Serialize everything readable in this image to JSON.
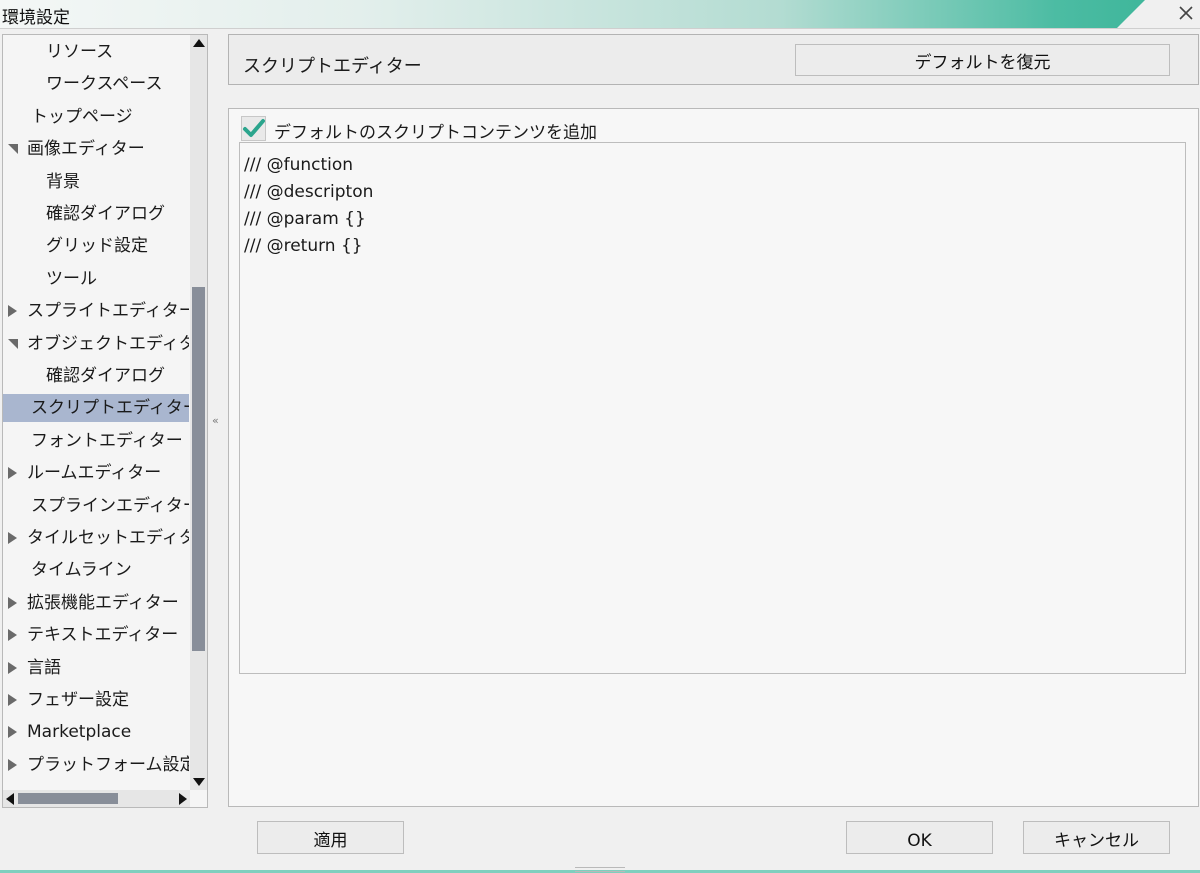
{
  "window": {
    "title": "環境設定"
  },
  "tree": {
    "items": [
      {
        "label": "リソース",
        "indent": 2,
        "expander": "none",
        "selected": false
      },
      {
        "label": "ワークスペース",
        "indent": 2,
        "expander": "none",
        "selected": false
      },
      {
        "label": "トップページ",
        "indent": 1,
        "expander": "none",
        "selected": false
      },
      {
        "label": "画像エディター",
        "indent": 1,
        "expander": "expanded",
        "selected": false
      },
      {
        "label": "背景",
        "indent": 2,
        "expander": "none",
        "selected": false
      },
      {
        "label": "確認ダイアログ",
        "indent": 2,
        "expander": "none",
        "selected": false
      },
      {
        "label": "グリッド設定",
        "indent": 2,
        "expander": "none",
        "selected": false
      },
      {
        "label": "ツール",
        "indent": 2,
        "expander": "none",
        "selected": false
      },
      {
        "label": "スプライトエディター",
        "indent": 1,
        "expander": "collapsed",
        "selected": false
      },
      {
        "label": "オブジェクトエディター",
        "indent": 1,
        "expander": "expanded",
        "selected": false
      },
      {
        "label": "確認ダイアログ",
        "indent": 2,
        "expander": "none",
        "selected": false
      },
      {
        "label": "スクリプトエディター",
        "indent": 1,
        "expander": "none",
        "selected": true
      },
      {
        "label": "フォントエディター",
        "indent": 1,
        "expander": "none",
        "selected": false
      },
      {
        "label": "ルームエディター",
        "indent": 1,
        "expander": "collapsed",
        "selected": false
      },
      {
        "label": "スプラインエディター",
        "indent": 1,
        "expander": "none",
        "selected": false
      },
      {
        "label": "タイルセットエディター",
        "indent": 1,
        "expander": "collapsed",
        "selected": false
      },
      {
        "label": "タイムライン",
        "indent": 1,
        "expander": "none",
        "selected": false
      },
      {
        "label": "拡張機能エディター",
        "indent": 1,
        "expander": "collapsed",
        "selected": false
      },
      {
        "label": "テキストエディター",
        "indent": 1,
        "expander": "collapsed",
        "selected": false
      },
      {
        "label": "言語",
        "indent": 1,
        "expander": "collapsed",
        "selected": false
      },
      {
        "label": "フェザー設定",
        "indent": 1,
        "expander": "collapsed",
        "selected": false
      },
      {
        "label": "Marketplace",
        "indent": 1,
        "expander": "collapsed",
        "selected": false
      },
      {
        "label": "プラットフォーム設定",
        "indent": 1,
        "expander": "collapsed",
        "selected": false
      }
    ]
  },
  "splitter": {
    "glyph": "«"
  },
  "panel": {
    "heading": "スクリプトエディター",
    "restore_label": "デフォルトを復元",
    "checkbox_label": "デフォルトのスクリプトコンテンツを追加",
    "checkbox_checked": true,
    "editor_lines": [
      "/// @function",
      "/// @descripton",
      "/// @param {}",
      "/// @return {}"
    ]
  },
  "footer": {
    "apply_label": "適用",
    "ok_label": "OK",
    "cancel_label": "キャンセル"
  },
  "colors": {
    "selection": "#a9b6cf",
    "check_accent": "#2ba58d",
    "title_accent": "#37b396"
  },
  "icons": {
    "close": "close-icon",
    "check": "check-icon",
    "expanded": "triangle-down-icon",
    "collapsed": "triangle-right-icon"
  }
}
